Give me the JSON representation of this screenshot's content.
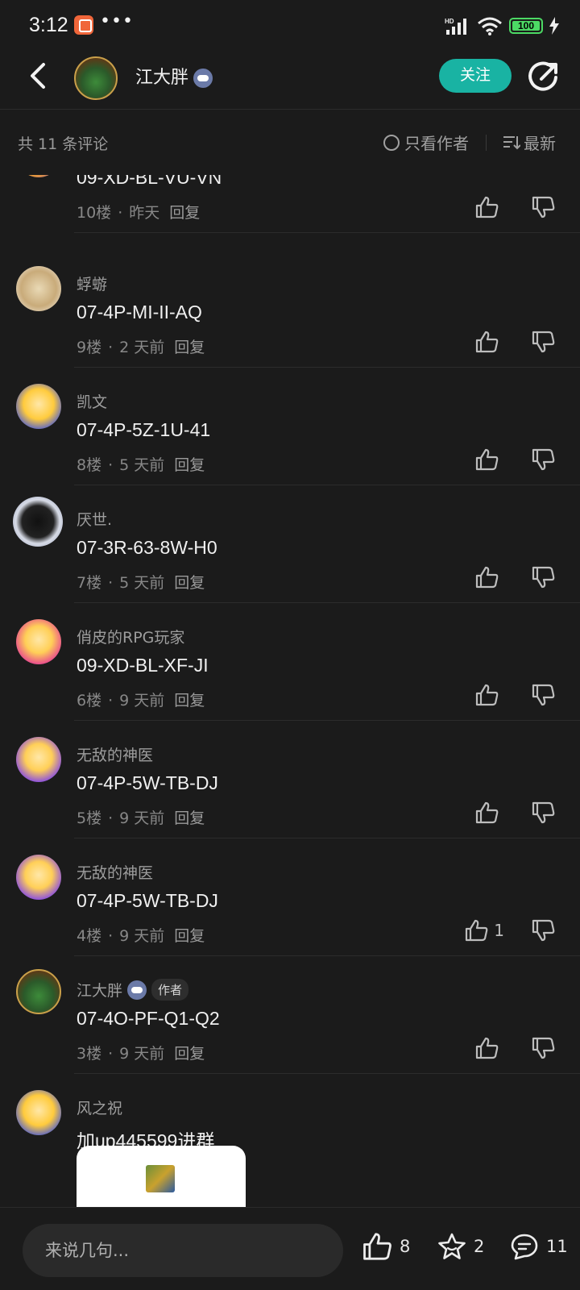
{
  "status_bar": {
    "time": "3:12",
    "dots": "•••",
    "battery": "100"
  },
  "header": {
    "author_name": "江大胖",
    "follow_label": "关注"
  },
  "subbar": {
    "count_label": "共 11 条评论",
    "only_author_label": "只看作者",
    "sort_label": "最新"
  },
  "comments": [
    {
      "name": "",
      "text": "09-XD-BL-VU-VN",
      "floor": "10楼",
      "time": "昨天",
      "reply": "回复",
      "likes": ""
    },
    {
      "name": "蜉蝣",
      "text": "07-4P-MI-II-AQ",
      "floor": "9楼",
      "time": "2 天前",
      "reply": "回复",
      "likes": ""
    },
    {
      "name": "凯文",
      "text": "07-4P-5Z-1U-41",
      "floor": "8楼",
      "time": "5 天前",
      "reply": "回复",
      "likes": ""
    },
    {
      "name": "厌世.",
      "text": "07-3R-63-8W-H0",
      "floor": "7楼",
      "time": "5 天前",
      "reply": "回复",
      "likes": ""
    },
    {
      "name": "俏皮的RPG玩家",
      "text": "09-XD-BL-XF-JI",
      "floor": "6楼",
      "time": "9 天前",
      "reply": "回复",
      "likes": ""
    },
    {
      "name": "无敌的神医",
      "text": "07-4P-5W-TB-DJ",
      "floor": "5楼",
      "time": "9 天前",
      "reply": "回复",
      "likes": ""
    },
    {
      "name": "无敌的神医",
      "text": "07-4P-5W-TB-DJ",
      "floor": "4楼",
      "time": "9 天前",
      "reply": "回复",
      "likes": "1"
    },
    {
      "name": "江大胖",
      "author_tag": "作者",
      "text": "07-4O-PF-Q1-Q2",
      "floor": "3楼",
      "time": "9 天前",
      "reply": "回复",
      "likes": ""
    },
    {
      "name": "风之祝",
      "text": "加up445599进群"
    }
  ],
  "bottom_bar": {
    "input_placeholder": "来说几句...",
    "like_count": "8",
    "star_count": "2",
    "comment_count": "11"
  },
  "colors": {
    "background": "#1b1b1b",
    "accent": "#19b3a3",
    "text_primary": "#f0f0f0",
    "text_secondary": "#9d9d9d"
  }
}
